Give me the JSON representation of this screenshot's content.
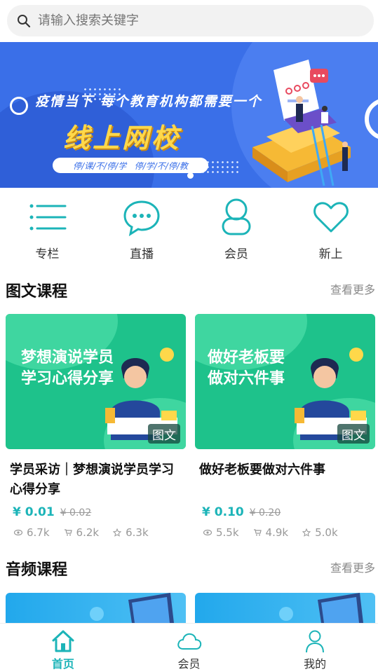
{
  "search": {
    "placeholder": "请输入搜索关键字"
  },
  "banner": {
    "headline": "疫情当下 每个教育机构都需要一个",
    "title": "线上网校",
    "slogan": "停/课/不/停/学   停/学/不/停/教"
  },
  "quicknav": [
    {
      "label": "专栏",
      "icon": "list-icon"
    },
    {
      "label": "直播",
      "icon": "chat-bubble-icon"
    },
    {
      "label": "会员",
      "icon": "person-icon"
    },
    {
      "label": "新上",
      "icon": "heart-icon"
    }
  ],
  "sections": {
    "graphic": {
      "title": "图文课程",
      "more": "查看更多"
    },
    "audio": {
      "title": "音频课程",
      "more": "查看更多"
    }
  },
  "courses": [
    {
      "cover_text": "梦想演说学员学习心得分享",
      "badge": "图文",
      "title": "学员采访｜梦想演说学员学习心得分享",
      "price": "¥ 0.01",
      "orig_price": "¥ 0.02",
      "views": "6.7k",
      "buys": "6.2k",
      "stars": "6.3k"
    },
    {
      "cover_text": "做好老板要做对六件事",
      "badge": "图文",
      "title": "做好老板要做对六件事",
      "price": "¥ 0.10",
      "orig_price": "¥ 0.20",
      "views": "5.5k",
      "buys": "4.9k",
      "stars": "5.0k"
    }
  ],
  "tabbar": [
    {
      "label": "首页",
      "icon": "home-icon",
      "active": true
    },
    {
      "label": "会员",
      "icon": "cloud-icon",
      "active": false
    },
    {
      "label": "我的",
      "icon": "user-icon",
      "active": false
    }
  ],
  "colors": {
    "accent": "#1cb4b8",
    "banner": "#3a6fe8",
    "cover": "#1ec28b"
  }
}
